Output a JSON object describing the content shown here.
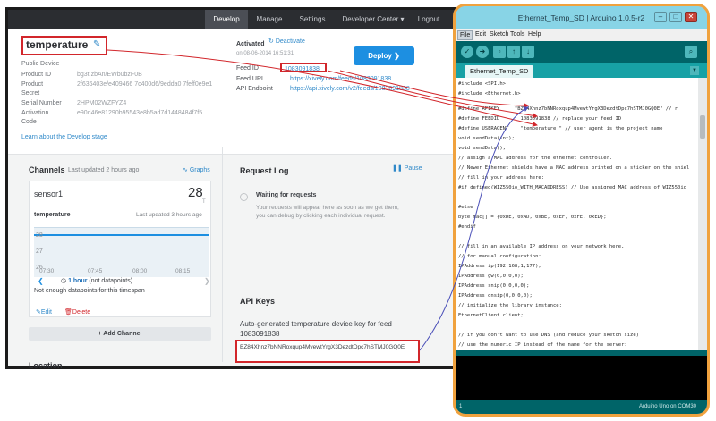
{
  "xively": {
    "nav": [
      "Develop",
      "Manage",
      "Settings",
      "Developer Center ▾",
      "Logout"
    ],
    "device_name": "temperature",
    "public_device": "Public Device",
    "fields": [
      {
        "key": "Product ID",
        "value": "bg3tIzbAn/EWb0bzF0B"
      },
      {
        "key": "Product",
        "value": "2f636403e/e409466 7c400d6/9edda0 7feff0e9e1"
      },
      {
        "key": "Secret",
        "value": ""
      },
      {
        "key": "Serial Number",
        "value": "2HPM02WZFYZ4"
      },
      {
        "key": "Activation",
        "value": "e90d46e81290b95543e8b5ad7d1448484f7f5"
      },
      {
        "key": "Code",
        "value": ""
      }
    ],
    "develop_link": "Learn about the Develop stage",
    "activated_label": "Activated",
    "activated_date": "on 08-06-2014 16:51:31",
    "deactivate": "Deactivate",
    "feed_id_label": "Feed ID",
    "feed_id": "1083091838",
    "feed_url_label": "Feed URL",
    "feed_url": "https://xively.com/feeds/1083091838",
    "api_endpoint_label": "API Endpoint",
    "api_endpoint": "https://api.xively.com/v2/feeds/1083091838",
    "deploy": "Deploy",
    "channels_title": "Channels",
    "channels_updated": "Last updated 2 hours ago",
    "graphs": "Graphs",
    "sensor_name": "sensor1",
    "sensor_value": "28",
    "sensor_unit": "T",
    "sensor_channel": "temperature",
    "sensor_updated": "Last updated 3 hours ago",
    "chart_y": [
      "28",
      "27",
      "26"
    ],
    "chart_x": [
      "07:30",
      "07:45",
      "08:00",
      "08:15"
    ],
    "range_label": "1 hour",
    "range_sub": "(not datapoints)",
    "no_data": "Not enough datapoints for this timespan",
    "edit": "Edit",
    "delete": "Delete",
    "add_channel": "Add Channel",
    "location": "Location",
    "request_log_title": "Request Log",
    "pause": "Pause",
    "waiting_title": "Waiting for requests",
    "waiting_text_1": "Your requests will appear here as soon as we get them,",
    "waiting_text_2": "you can debug by clicking each individual request.",
    "api_keys_title": "API Keys",
    "api_key_desc_1": "Auto-generated temperature device key for feed",
    "api_key_desc_2": "1083091838",
    "api_key_value": "BZ84Xhnz7bNNRoxqup4MvewtYrgX3DezdtDpc7hSTMJ0GQ0E"
  },
  "arduino": {
    "title": "Ethernet_Temp_SD | Arduino 1.0.5-r2",
    "menus": [
      "File",
      "Edit",
      "Sketch",
      "Tools",
      "Help"
    ],
    "tab": "Ethernet_Temp_SD",
    "code": [
      "#include <SPI.h>",
      "#include <Ethernet.h>",
      "",
      "",
      "#define APIKEY     \"BZ84Xhnz7bNNRoxqup4MvewtYrgX3DezdtDpc7hSTMJ0GQ0E\" // r",
      "#define FEEDID       1083091838 // replace your feed ID",
      "#define USERAGENT    \"temperature \" // user agent is the project name",
      "void sendData(int);",
      "void sendData();",
      "// assign a MAC address for the ethernet controller.",
      "// Newer Ethernet shields have a MAC address printed on a sticker on the shiel",
      "// fill in your address here:",
      "#if defined(WIZ550io_WITH_MACADDRESS) // Use assigned MAC address of WIZ550io",
      "",
      "#else",
      "byte mac[] = {0xDE, 0xAD, 0xBE, 0xEF, 0xFE, 0xED};",
      "#endif",
      "",
      "",
      "// fill in an available IP address on your network here,",
      "// for manual configuration:",
      "IPAddress ip(192,168,1,177);",
      "IPAddress gw(0,0,0,0);",
      "IPAddress snip(0,0,0,0);",
      "IPAddress dnsip(0,0,0,0);",
      "// initialize the library instance:",
      "EthernetClient client;",
      "",
      "// if you don't want to use DNS (and reduce your sketch size)",
      "// use the numeric IP instead of the name for the server:"
    ],
    "status": "Arduino Uno on COM30",
    "line_number": "1"
  }
}
